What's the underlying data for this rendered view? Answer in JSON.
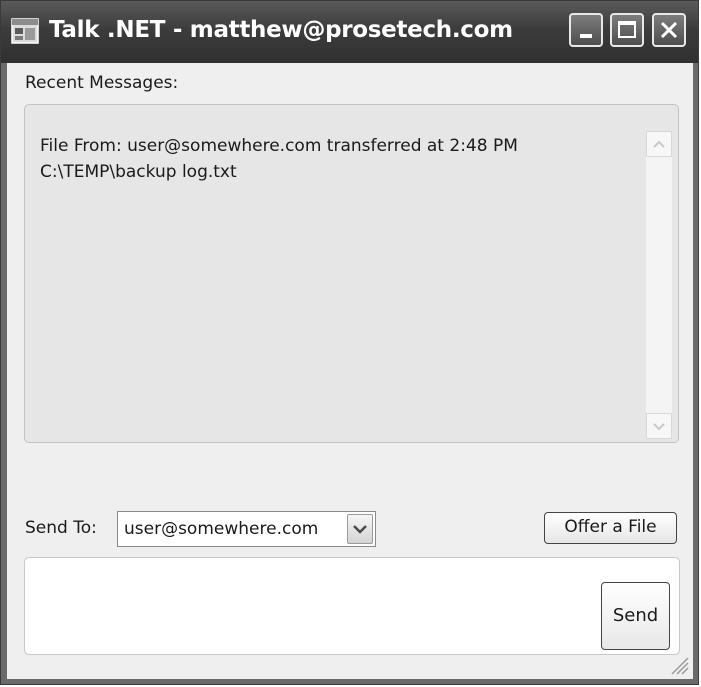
{
  "window": {
    "title": "Talk .NET - matthew@prosetech.com",
    "icon": "app-window-icon",
    "controls": {
      "minimize_icon": "minimize-icon",
      "maximize_icon": "maximize-icon",
      "close_icon": "close-icon"
    }
  },
  "recent": {
    "label": "Recent Messages:",
    "lines": [
      "File From: user@somewhere.com transferred at 2:48 PM",
      "C:\\TEMP\\backup log.txt"
    ]
  },
  "send_to": {
    "label": "Send To:",
    "selected": "user@somewhere.com"
  },
  "buttons": {
    "offer_file": "Offer a File",
    "send": "Send"
  },
  "compose": {
    "value": ""
  }
}
